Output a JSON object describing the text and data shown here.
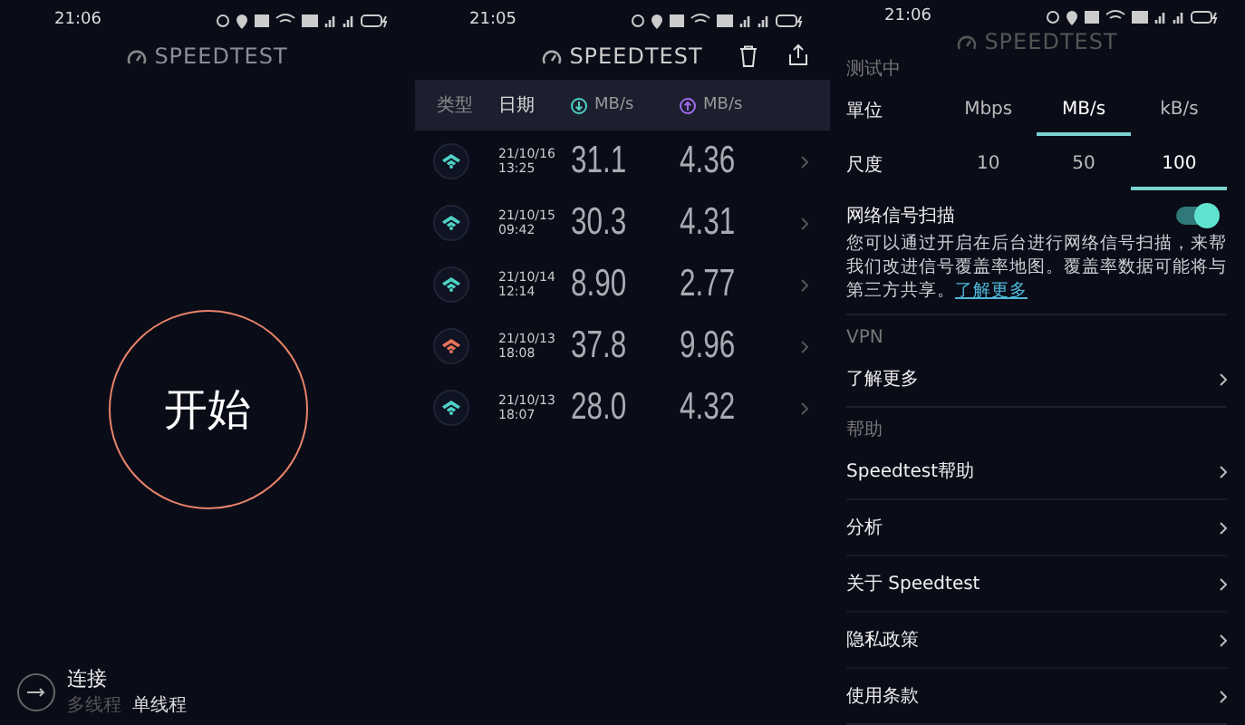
{
  "start_screen": {
    "status_bar": {
      "time": "21:06"
    },
    "app_title": "SPEEDTEST",
    "start_button": "开始",
    "connection": {
      "label": "连接",
      "modes": [
        {
          "label": "多线程",
          "selected": false
        },
        {
          "label": "单线程",
          "selected": true
        }
      ]
    }
  },
  "history_screen": {
    "status_bar": {
      "time": "21:05"
    },
    "app_title": "SPEEDTEST",
    "columns": {
      "type": "类型",
      "date": "日期",
      "download": "MB/s",
      "upload": "MB/s"
    },
    "rows": [
      {
        "date": "21/10/16",
        "time": "13:25",
        "download": "31.1",
        "upload": "4.36",
        "color": "#4fd1c5"
      },
      {
        "date": "21/10/15",
        "time": "09:42",
        "download": "30.3",
        "upload": "4.31",
        "color": "#4fd1c5"
      },
      {
        "date": "21/10/14",
        "time": "12:14",
        "download": "8.90",
        "upload": "2.77",
        "color": "#4fd1c5"
      },
      {
        "date": "21/10/13",
        "time": "18:08",
        "download": "37.8",
        "upload": "9.96",
        "color": "#e8735a"
      },
      {
        "date": "21/10/13",
        "time": "18:07",
        "download": "28.0",
        "upload": "4.32",
        "color": "#4fd1c5"
      }
    ]
  },
  "settings_screen": {
    "status_bar": {
      "time": "21:06"
    },
    "app_title": "SPEEDTEST",
    "section_label": "测试中",
    "unit": {
      "label": "單位",
      "options": [
        {
          "label": "Mbps",
          "selected": false
        },
        {
          "label": "MB/s",
          "selected": true
        },
        {
          "label": "kB/s",
          "selected": false
        }
      ]
    },
    "scale": {
      "label": "尺度",
      "options": [
        {
          "label": "10",
          "selected": false
        },
        {
          "label": "50",
          "selected": false
        },
        {
          "label": "100",
          "selected": true
        }
      ]
    },
    "scan": {
      "label": "网络信号扫描",
      "on": true,
      "description": "您可以通过开启在后台进行网络信号扫描，来帮我们改进信号覆盖率地图。覆盖率数据可能将与第三方共享。",
      "link": "了解更多"
    },
    "sections": [
      {
        "title": "VPN",
        "items": [
          "了解更多"
        ]
      },
      {
        "title": "帮助",
        "items": [
          "Speedtest帮助",
          "分析",
          "关于 Speedtest",
          "隐私政策",
          "使用条款"
        ]
      }
    ]
  }
}
